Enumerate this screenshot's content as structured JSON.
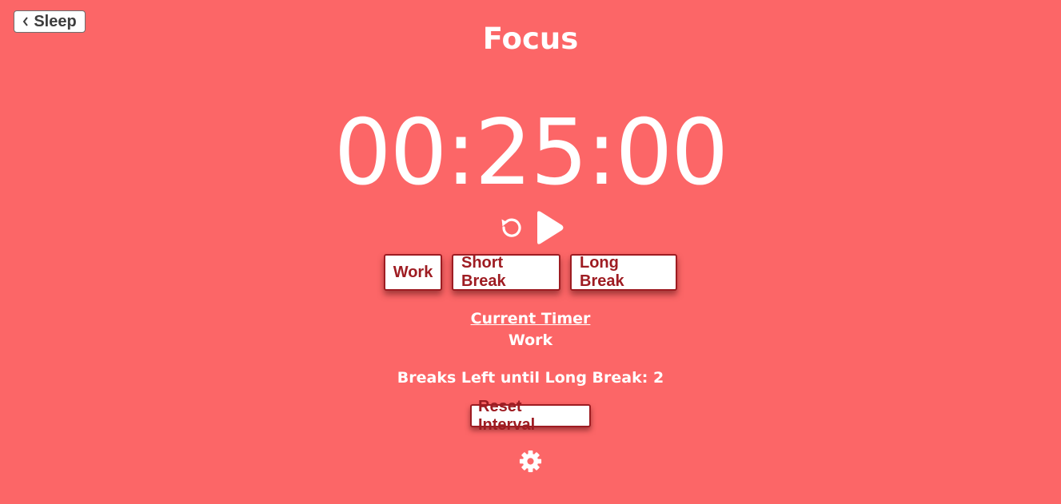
{
  "header": {
    "back_label": "Sleep",
    "title": "Focus"
  },
  "timer": {
    "display": "00:25:00"
  },
  "controls": {
    "restart_icon": "restart-icon",
    "play_icon": "play-icon"
  },
  "modes": [
    {
      "label": "Work"
    },
    {
      "label": "Short Break"
    },
    {
      "label": "Long Break"
    }
  ],
  "current_timer": {
    "label": "Current Timer",
    "value": "Work"
  },
  "breaks": {
    "text": "Breaks Left until Long Break: 2"
  },
  "interval": {
    "reset_label": "Reset Interval"
  },
  "settings": {
    "icon": "gear-icon"
  },
  "colors": {
    "background": "#fc6667",
    "accent": "#9e1c22",
    "text": "#ffffff"
  }
}
